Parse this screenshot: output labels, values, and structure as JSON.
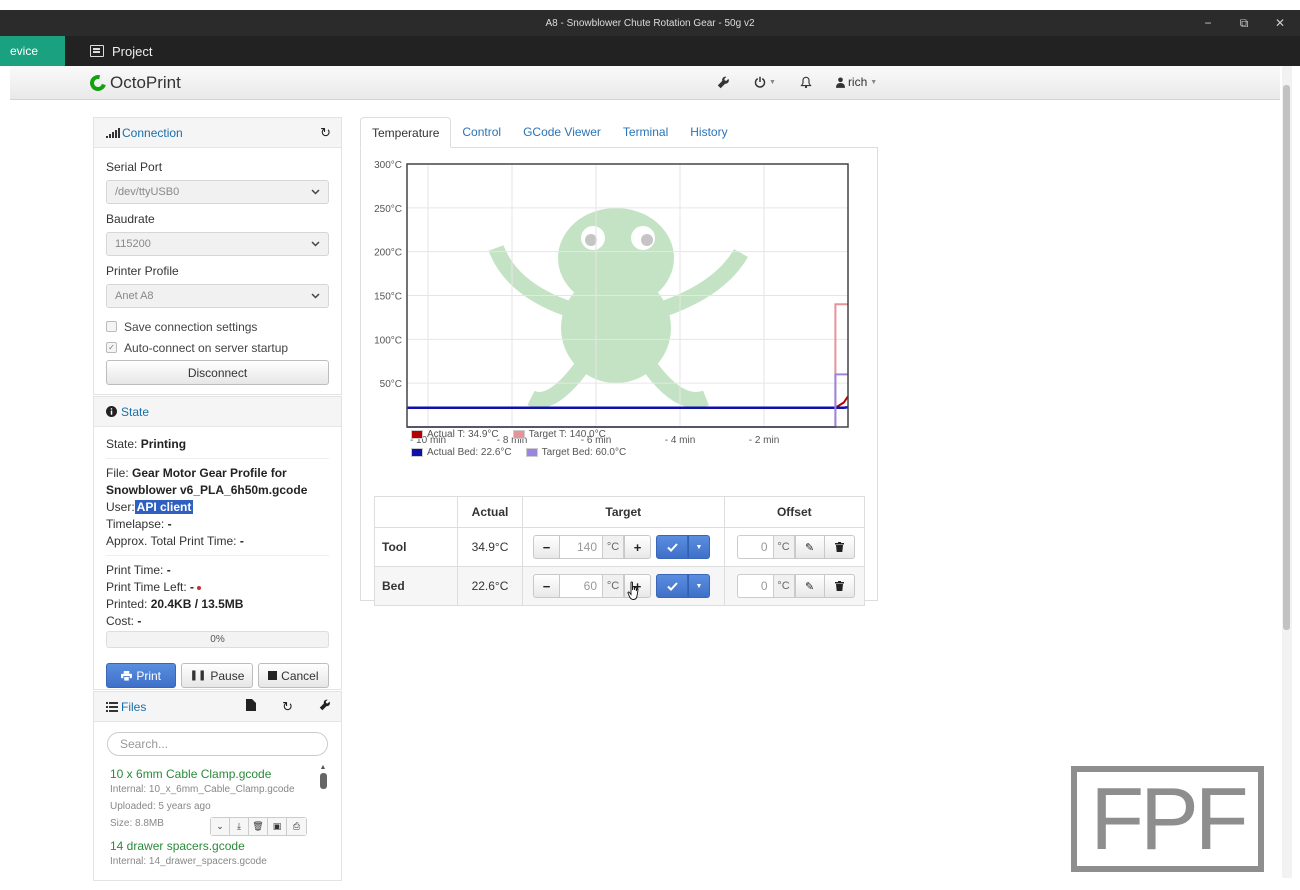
{
  "window": {
    "title": "A8 - Snowblower Chute Rotation Gear - 50g v2",
    "controls": [
      "−",
      "⧉",
      "✕"
    ]
  },
  "apptabs": {
    "device": "evice",
    "project": "Project"
  },
  "navbar": {
    "brand": "OctoPrint",
    "user": "rich"
  },
  "connection": {
    "title": "Connection",
    "serial_port_label": "Serial Port",
    "serial_port": "/dev/ttyUSB0",
    "baudrate_label": "Baudrate",
    "baudrate": "115200",
    "profile_label": "Printer Profile",
    "profile": "Anet A8",
    "save_settings": "Save connection settings",
    "auto_connect": "Auto-connect on server startup",
    "disconnect": "Disconnect"
  },
  "state": {
    "title": "State",
    "state_label": "State:",
    "state_value": "Printing",
    "file_label": "File:",
    "file_value": "Gear Motor Gear Profile for Snowblower v6_PLA_6h50m.gcode",
    "user_label": "User:",
    "user_value": "API client",
    "timelapse_label": "Timelapse:",
    "timelapse_value": "-",
    "total_time_label": "Approx. Total Print Time:",
    "total_time_value": "-",
    "print_time_label": "Print Time:",
    "print_time_value": "-",
    "time_left_label": "Print Time Left:",
    "time_left_value": "-",
    "printed_label": "Printed:",
    "printed_value": "20.4KB / 13.5MB",
    "cost_label": "Cost:",
    "cost_value": "-",
    "progress": "0%",
    "progress_fraction": 0,
    "print": "Print",
    "pause": "Pause",
    "cancel": "Cancel"
  },
  "files": {
    "title": "Files",
    "search_placeholder": "Search...",
    "items": [
      {
        "name": "10 x 6mm Cable Clamp.gcode",
        "internal": "Internal: 10_x_6mm_Cable_Clamp.gcode",
        "uploaded": "Uploaded: 5 years ago",
        "size": "Size: 8.8MB"
      },
      {
        "name": "14 drawer spacers.gcode",
        "internal": "Internal: 14_drawer_spacers.gcode"
      }
    ]
  },
  "tabs": [
    "Temperature",
    "Control",
    "GCode Viewer",
    "Terminal",
    "History"
  ],
  "chart_data": {
    "type": "line",
    "y_ticks": [
      "300°C",
      "250°C",
      "200°C",
      "150°C",
      "100°C",
      "50°C"
    ],
    "x_ticks": [
      "- 10 min",
      "- 8 min",
      "- 6 min",
      "- 4 min",
      "- 2 min"
    ],
    "ylim": [
      0,
      300
    ],
    "legend": [
      "Actual T: 34.9°C",
      "Target T: 140.0°C",
      "Actual Bed: 22.6°C",
      "Target Bed: 60.0°C"
    ],
    "colors": {
      "actual_tool": "#b30000",
      "target_tool": "#e5949a",
      "actual_bed": "#1010a8",
      "target_bed": "#9a86de"
    },
    "series": [
      {
        "name": "Actual T",
        "x": [
          -10.5,
          -0.3,
          -0.1,
          0
        ],
        "y": [
          22,
          22,
          28,
          35
        ]
      },
      {
        "name": "Target T",
        "x": [
          -10.5,
          -0.3,
          -0.3,
          0
        ],
        "y": [
          0,
          0,
          140,
          140
        ]
      },
      {
        "name": "Actual Bed",
        "x": [
          -10.5,
          -0.1,
          0
        ],
        "y": [
          22,
          22,
          22.6
        ]
      },
      {
        "name": "Target Bed",
        "x": [
          -10.5,
          -0.3,
          -0.3,
          0
        ],
        "y": [
          0,
          0,
          60,
          60
        ]
      }
    ]
  },
  "temps": {
    "headers": [
      "Actual",
      "Target",
      "Offset"
    ],
    "unit": "°C",
    "tool": {
      "label": "Tool",
      "actual": "34.9°C",
      "target": "140",
      "offset": "0"
    },
    "bed": {
      "label": "Bed",
      "actual": "22.6°C",
      "target": "60",
      "offset": "0"
    }
  },
  "watermark": "FPF"
}
